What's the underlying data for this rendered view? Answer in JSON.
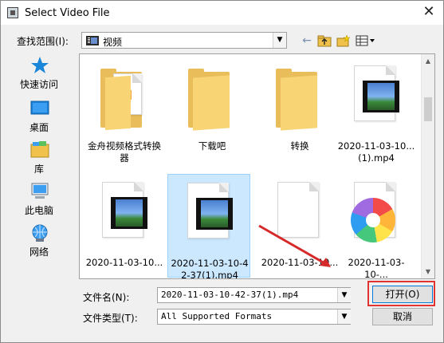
{
  "window": {
    "title": "Select Video File",
    "close_glyph": "✕"
  },
  "lookin": {
    "label": "查找范围(I):",
    "value": "视频"
  },
  "places": [
    {
      "label": "快速访问",
      "icon": "star-icon"
    },
    {
      "label": "桌面",
      "icon": "desktop-icon"
    },
    {
      "label": "库",
      "icon": "library-icon"
    },
    {
      "label": "此电脑",
      "icon": "computer-icon"
    },
    {
      "label": "网络",
      "icon": "network-icon"
    }
  ],
  "files": [
    {
      "label": "",
      "type": "document-folder"
    },
    {
      "label": "下载吧",
      "type": "folder"
    },
    {
      "label": "转换",
      "type": "folder"
    },
    {
      "label": "2020-11-03-10...\n(1).mp4",
      "type": "video"
    },
    {
      "label": "金舟视频格式转换\n器",
      "type": "folder-doc"
    },
    {
      "label": "2020-11-03-10...",
      "type": "video"
    },
    {
      "label": "2020-11-03-10-42-37(1).mp4",
      "type": "video"
    },
    {
      "label": "2020-11-03-10...",
      "type": "blank"
    },
    {
      "label": "2020-11-03-10-...",
      "type": "app"
    }
  ],
  "filename": {
    "label": "文件名(N):",
    "value": "2020-11-03-10-42-37(1).mp4"
  },
  "filetype": {
    "label": "文件类型(T):",
    "value": "All Supported Formats"
  },
  "buttons": {
    "open": "打开(O)",
    "cancel": "取消"
  },
  "colors": {
    "selection": "#cce8ff",
    "highlight": "#e23232",
    "folder": "#f8d475"
  }
}
